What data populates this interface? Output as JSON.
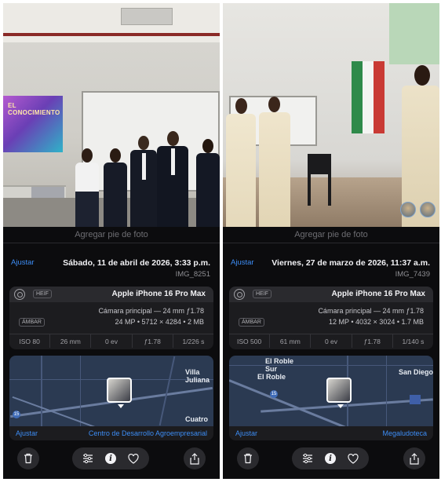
{
  "left": {
    "photo": {
      "screen_text": "EL CONOCIMIENTO"
    },
    "caption_placeholder": "Agregar pie de foto",
    "adjust_label": "Ajustar",
    "date": "Sábado, 11 de abril de 2026, 3:33 p.m.",
    "filename": "IMG_8251",
    "device": "Apple iPhone 16 Pro Max",
    "format_badge": "HEIF",
    "camera_line": "Cámara principal — 24 mm ƒ1.78",
    "resolution_line": "24 MP • 5712 × 4284 • 2 MB",
    "extra_badge": "ÁMBAR",
    "stats": [
      "ISO 80",
      "26 mm",
      "0 ev",
      "ƒ1.78",
      "1/226 s"
    ],
    "map_labels": [
      "Villa Juliana",
      "Cuatro"
    ],
    "map_shield": "15",
    "location": "Centro de Desarrollo Agroempresarial",
    "map_adjust": "Ajustar"
  },
  "right": {
    "caption_placeholder": "Agregar pie de foto",
    "adjust_label": "Ajustar",
    "date": "Viernes, 27 de marzo de 2026, 11:37 a.m.",
    "filename": "IMG_7439",
    "device": "Apple iPhone 16 Pro Max",
    "format_badge": "HEIF",
    "camera_line": "Cámara principal — 24 mm ƒ1.78",
    "resolution_line": "12 MP • 4032 × 3024 • 1.7 MB",
    "extra_badge": "ÁMBAR",
    "stats": [
      "ISO 500",
      "61 mm",
      "0 ev",
      "ƒ1.78",
      "1/140 s"
    ],
    "map_labels": [
      "El Roble Sur",
      "El Roble",
      "San Diego"
    ],
    "map_shield": "15",
    "location": "Megaludoteca",
    "map_adjust": "Ajustar"
  },
  "colors": {
    "accent": "#3d8df5",
    "sheet": "#0c0c0e",
    "card": "#1c1c1f"
  },
  "icons": [
    "trash-icon",
    "sliders-icon",
    "info-icon",
    "heart-icon",
    "share-icon",
    "lens-icon"
  ]
}
